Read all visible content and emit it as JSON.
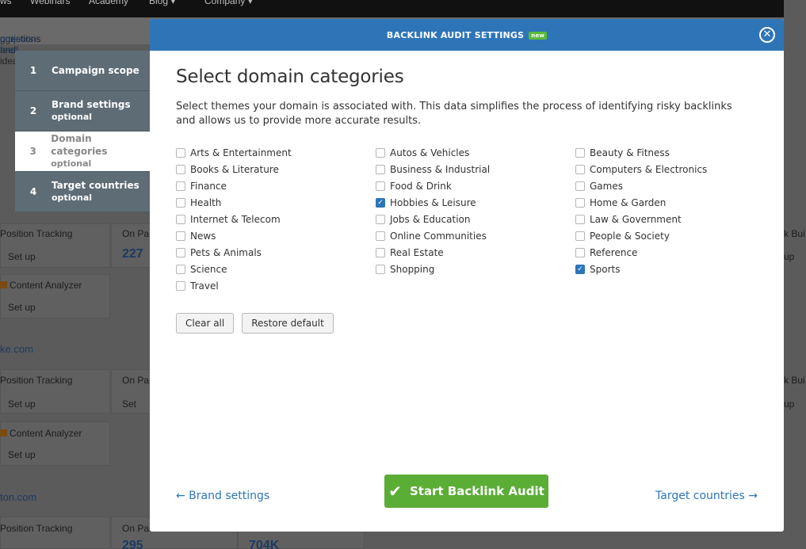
{
  "background": {
    "nav": [
      "ws",
      "Webinars",
      "Academy",
      "Blog ▾",
      "Company ▾"
    ],
    "subbar_text": "ggestions and ideas to ",
    "subbar_link": "projects-feed",
    "cards": {
      "position_tracking": "Position Tracking",
      "set_up": "Set up",
      "on_page": "On Pa",
      "count_227": "227",
      "content_analyzer": "Content Analyzer",
      "domain_like": "ke.com",
      "domain_ton": "ton.com",
      "count_295": "295",
      "count_704k": "704K",
      "backlink_bui": "k Bui",
      "up": "up",
      "set": "Set"
    }
  },
  "steps": [
    {
      "num": "1",
      "label": "Campaign scope",
      "sub": ""
    },
    {
      "num": "2",
      "label": "Brand settings",
      "sub": "optional"
    },
    {
      "num": "3",
      "label": "Domain categories",
      "sub": "optional"
    },
    {
      "num": "4",
      "label": "Target countries",
      "sub": "optional"
    }
  ],
  "modal": {
    "title": "BACKLINK AUDIT SETTINGS",
    "badge": "new",
    "close": "✕",
    "heading": "Select domain categories",
    "description": "Select themes your domain is associated with. This data simplifies the process of identifying risky backlinks and allows us to provide more accurate results.",
    "categories": {
      "col1": [
        {
          "label": "Arts & Entertainment",
          "checked": false
        },
        {
          "label": "Books & Literature",
          "checked": false
        },
        {
          "label": "Finance",
          "checked": false
        },
        {
          "label": "Health",
          "checked": false
        },
        {
          "label": "Internet & Telecom",
          "checked": false
        },
        {
          "label": "News",
          "checked": false
        },
        {
          "label": "Pets & Animals",
          "checked": false
        },
        {
          "label": "Science",
          "checked": false
        },
        {
          "label": "Travel",
          "checked": false
        }
      ],
      "col2": [
        {
          "label": "Autos & Vehicles",
          "checked": false
        },
        {
          "label": "Business & Industrial",
          "checked": false
        },
        {
          "label": "Food & Drink",
          "checked": false
        },
        {
          "label": "Hobbies & Leisure",
          "checked": true
        },
        {
          "label": "Jobs & Education",
          "checked": false
        },
        {
          "label": "Online Communities",
          "checked": false
        },
        {
          "label": "Real Estate",
          "checked": false
        },
        {
          "label": "Shopping",
          "checked": false
        }
      ],
      "col3": [
        {
          "label": "Beauty & Fitness",
          "checked": false
        },
        {
          "label": "Computers & Electronics",
          "checked": false
        },
        {
          "label": "Games",
          "checked": false
        },
        {
          "label": "Home & Garden",
          "checked": false
        },
        {
          "label": "Law & Government",
          "checked": false
        },
        {
          "label": "People & Society",
          "checked": false
        },
        {
          "label": "Reference",
          "checked": false
        },
        {
          "label": "Sports",
          "checked": true
        }
      ]
    },
    "clear_all": "Clear all",
    "restore_default": "Restore default",
    "prev_link": "← Brand settings",
    "start_button": "Start Backlink Audit",
    "next_link": "Target countries →"
  },
  "colors": {
    "header_blue": "#2e75b8",
    "start_green": "#5aad35",
    "new_badge": "#5aba3a"
  }
}
